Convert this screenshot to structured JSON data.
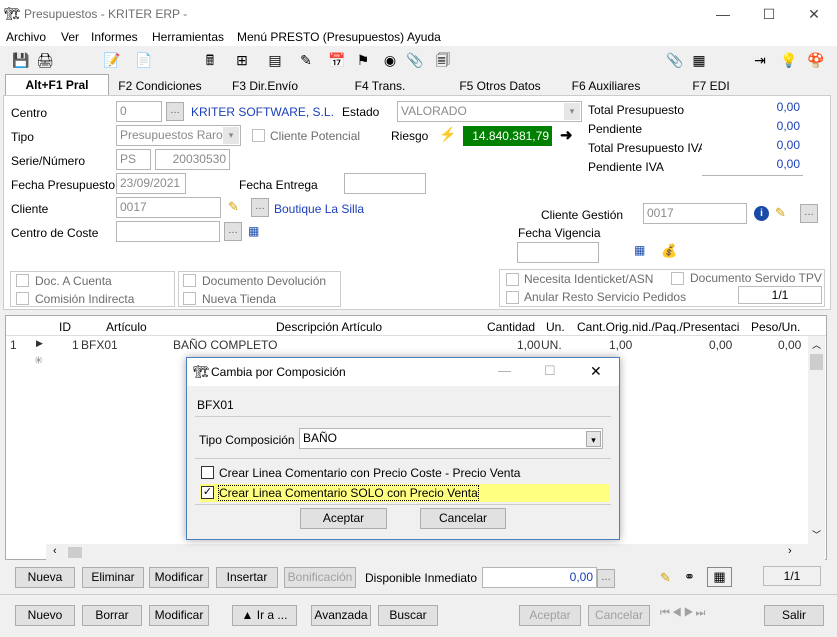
{
  "window": {
    "title": "Presupuestos - KRITER ERP -",
    "minimize": "—",
    "maximize": "☐",
    "close": "✕"
  },
  "menu": [
    "Archivo",
    "Ver",
    "Informes",
    "Herramientas",
    "Menú PRESTO (Presupuestos)",
    "Ayuda"
  ],
  "tabs": [
    "Alt+F1 Pral",
    "F2 Condiciones",
    "F3 Dir.Envío",
    "F4 Trans.",
    "F5 Otros Datos",
    "F6 Auxiliares",
    "F7 EDI"
  ],
  "form": {
    "centro_label": "Centro",
    "centro_value": "0",
    "centro_name": "KRITER SOFTWARE, S.L.",
    "estado_label": "Estado",
    "estado_value": "VALORADO",
    "tipo_label": "Tipo",
    "tipo_value": "Presupuestos Raros",
    "cliente_potencial": "Cliente Potencial",
    "riesgo_label": "Riesgo",
    "riesgo_value": "14.840.381,79",
    "serie_label": "Serie/Número",
    "serie_value": "PS",
    "numero_value": "20030530",
    "fecha_pres_label": "Fecha Presupuesto",
    "fecha_pres_value": "23/09/2021",
    "fecha_entrega_label": "Fecha Entrega",
    "fecha_entrega_value": "",
    "cliente_label": "Cliente",
    "cliente_value": "0017",
    "cliente_name": "Boutique La Silla",
    "centro_coste_label": "Centro de Coste",
    "cliente_gestion_label": "Cliente Gestión",
    "cliente_gestion_value": "0017",
    "fecha_vigencia_label": "Fecha Vigencia",
    "total_pres_label": "Total Presupuesto",
    "total_pres_value": "0,00",
    "pendiente_label": "Pendiente",
    "pendiente_value": "0,00",
    "total_pres_iva_label": "Total Presupuesto IVA",
    "total_pres_iva_value": "0,00",
    "pendiente_iva_label": "Pendiente IVA",
    "pendiente_iva_value": "0,00",
    "checks": {
      "doc_cuenta": "Doc. A Cuenta",
      "comision": "Comisión Indirecta",
      "doc_devolucion": "Documento Devolución",
      "nueva_tienda": "Nueva Tienda",
      "necesita": "Necesita Identicket/ASN",
      "doc_servido": "Documento Servido TPV",
      "anular": "Anular Resto Servicio Pedidos"
    },
    "page_counter": "1/1"
  },
  "grid": {
    "headers": [
      "ID",
      "Artículo",
      "Descripción Artículo",
      "Cantidad",
      "Un.",
      "Cant.Orig.",
      "nid./Paq./Presentaci",
      "Peso/Un."
    ],
    "row": {
      "num": "1",
      "id": "1",
      "articulo": "BFX01",
      "descripcion": "BAÑO COMPLETO",
      "cantidad": "1,00",
      "un": "UN.",
      "cant_orig": "1,00",
      "paq": "0,00",
      "peso": "0,00"
    }
  },
  "lines_bar": {
    "nueva": "Nueva",
    "eliminar": "Eliminar",
    "modificar": "Modificar",
    "insertar": "Insertar",
    "bonificacion": "Bonificación",
    "disponible_label": "Disponible Inmediato",
    "disponible_value": "0,00",
    "page": "1/1"
  },
  "bottom_bar": {
    "nuevo": "Nuevo",
    "borrar": "Borrar",
    "modificar": "Modificar",
    "ir_a": "▲ Ir a ...",
    "avanzada": "Avanzada",
    "buscar": "Buscar",
    "aceptar": "Aceptar",
    "cancelar": "Cancelar",
    "salir": "Salir"
  },
  "dialog": {
    "title": "Cambia por Composición",
    "code": "BFX01",
    "tipo_label": "Tipo Composición",
    "tipo_value": "BAÑO",
    "option1": "Crear Linea Comentario con Precio Coste - Precio Venta",
    "option2": "Crear Linea Comentario SOLO con Precio Venta",
    "aceptar": "Aceptar",
    "cancelar": "Cancelar"
  },
  "colors": {
    "riesgo_bg": "#008000",
    "link_blue": "#1a3fb8",
    "highlight": "#ffff7f"
  }
}
